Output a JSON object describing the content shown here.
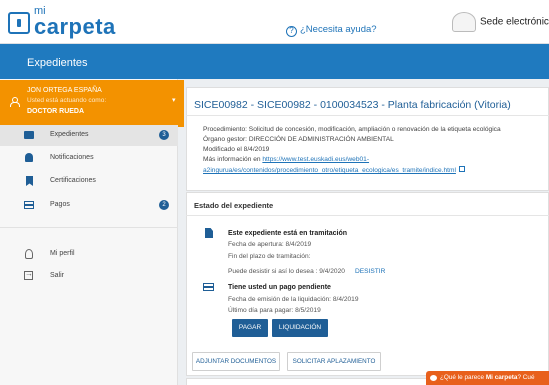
{
  "header": {
    "logo_mi": "mi",
    "logo_carpeta": "carpeta",
    "help_icon": "question-circle-icon",
    "help_label": "¿Necesita ayuda?",
    "sede_label": "Sede electrónica"
  },
  "bluebar": {
    "title": "Expedientes"
  },
  "user": {
    "name": "JON ORTEGA ESPAÑA",
    "acting_as": "Usted está actuando como:",
    "role": "DOCTOR RUEDA",
    "caret": "▾"
  },
  "sidebar": {
    "items": [
      {
        "label": "Expedientes",
        "icon": "folder-icon",
        "badge": "3"
      },
      {
        "label": "Notificaciones",
        "icon": "bell-icon"
      },
      {
        "label": "Certificaciones",
        "icon": "bookmark-icon"
      },
      {
        "label": "Pagos",
        "icon": "credit-card-icon",
        "badge": "2"
      },
      {
        "label": "Mi perfil",
        "icon": "person-icon"
      },
      {
        "label": "Salir",
        "icon": "exit-icon"
      }
    ]
  },
  "expediente": {
    "title": "SICE00982 - SICE00982 - 0100034523 - Planta fabricación (Vitoria)",
    "procedimiento": "Procedimiento: Solicitud de concesión, modificación, ampliación o renovación de la etiqueta ecológica",
    "organo": "Órgano gestor: DIRECCIÓN DE ADMINISTRACIÓN AMBIENTAL",
    "modificado": "Modificado el 8/4/2019",
    "mas_info_label": "Más información en ",
    "link_line1": "https://www.test.euskadi.eus/web01-",
    "link_line2": "a2ingurua/es/contenidos/procedimiento_otro/etiqueta_ecologica/es_tramite/indice.html"
  },
  "estado": {
    "title": "Estado del expediente",
    "tramitacion_head": "Este expediente está en tramitación",
    "fecha_apertura": "Fecha de apertura: 8/4/2019",
    "fin_plazo": "Fin del plazo de tramitación:",
    "desistir_text": "Puede desistir si así lo desea : 9/4/2020",
    "desistir_link": "DESISTIR",
    "pago_head": "Tiene usted un pago pendiente",
    "fecha_emision": "Fecha de emisión de la liquidación: 8/4/2019",
    "ultimo_dia": "Último día para pagar: 8/5/2019",
    "pagar_button": "PAGAR",
    "liquidacion_button": "LIQUIDACIÓN",
    "adjuntar_button": "ADJUNTAR DOCUMENTOS",
    "aplazamiento_button": "SOLICITAR APLAZAMIENTO"
  },
  "feedback": {
    "prefix": "¿Qué le parece ",
    "brand": "Mi carpeta",
    "suffix": "? Cué"
  },
  "colors": {
    "primary_blue": "#1f7abf",
    "dark_blue": "#1f5e96",
    "orange": "#f39200",
    "feedback_orange": "#e8601c"
  }
}
